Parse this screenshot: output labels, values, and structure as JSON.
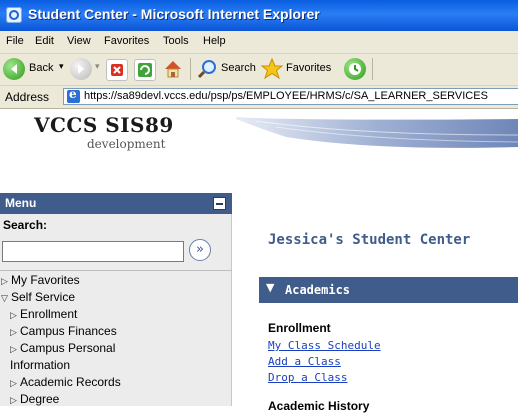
{
  "window": {
    "title": "Student Center - Microsoft Internet Explorer"
  },
  "menubar": [
    "File",
    "Edit",
    "View",
    "Favorites",
    "Tools",
    "Help"
  ],
  "toolbar": {
    "back": "Back",
    "search": "Search",
    "favorites": "Favorites"
  },
  "address": {
    "label": "Address",
    "url": "https://sa89devl.vccs.edu/psp/ps/EMPLOYEE/HRMS/c/SA_LEARNER_SERVICES"
  },
  "header": {
    "logo_main": "VCCS SIS89",
    "logo_sub": "development"
  },
  "menu": {
    "title": "Menu",
    "search_label": "Search:",
    "search_value": "",
    "items": {
      "favorites": "My Favorites",
      "self_service": "Self Service",
      "enrollment": "Enrollment",
      "campus_finances": "Campus Finances",
      "campus_personal": "Campus Personal",
      "campus_personal_2": "Information",
      "academic_records": "Academic Records",
      "degree": "Degree"
    }
  },
  "main": {
    "title": "Jessica's Student Center",
    "section": "Academics",
    "enrollment_heading": "Enrollment",
    "links": [
      "My Class Schedule",
      "Add a Class",
      "Drop a Class"
    ],
    "cut_text": "Academic History"
  },
  "colors": {
    "accent": "#3f5c8a",
    "link": "#1a3fbf",
    "titlebar": "#0a5fe0"
  }
}
